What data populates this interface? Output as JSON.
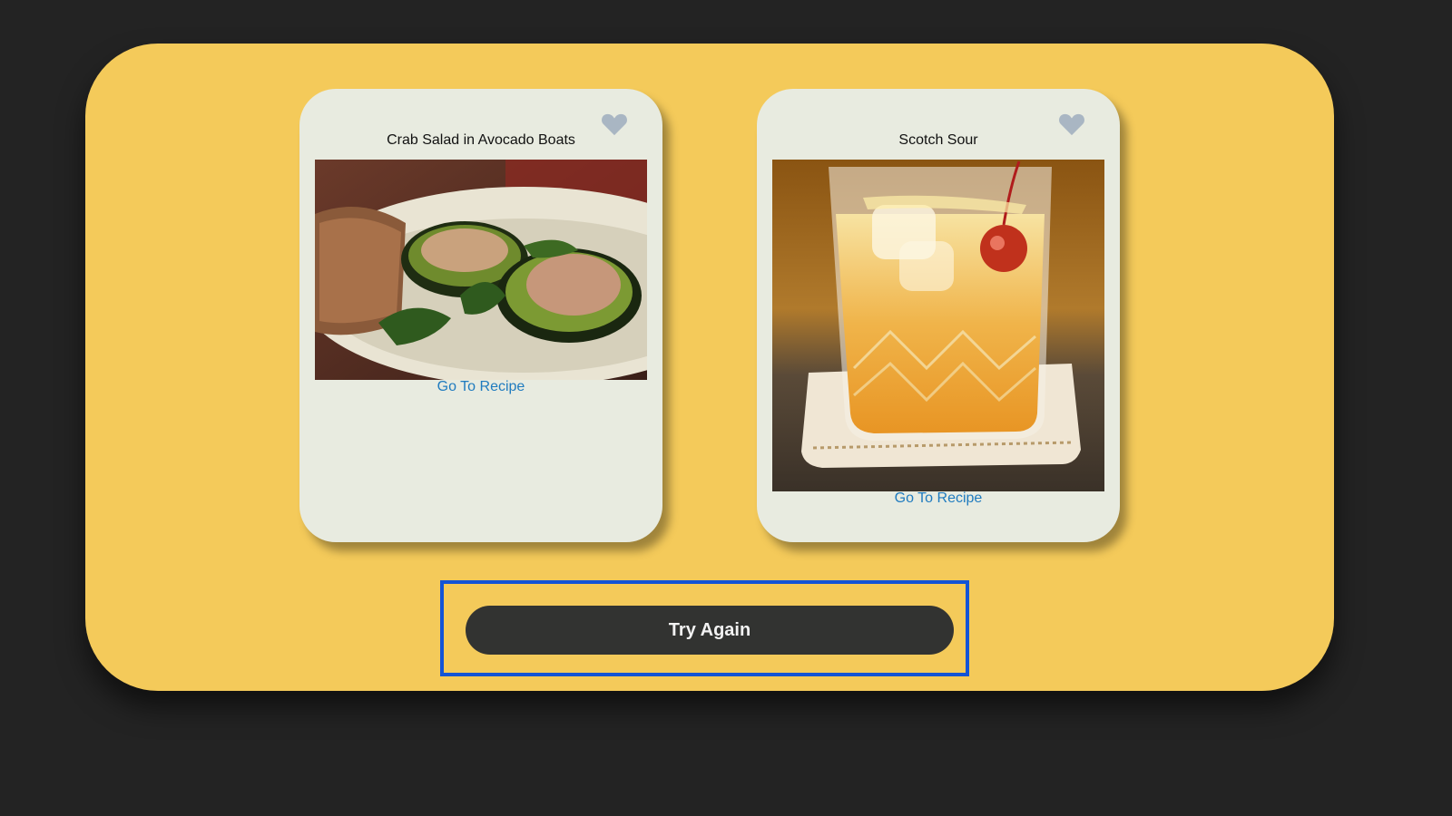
{
  "cards": [
    {
      "title": "Crab Salad in Avocado Boats",
      "link_label": "Go To Recipe",
      "favorite_icon": "heart-icon",
      "photo": "food-photo"
    },
    {
      "title": "Scotch Sour",
      "link_label": "Go To Recipe",
      "favorite_icon": "heart-icon",
      "photo": "drink-photo"
    }
  ],
  "action": {
    "button_label": "Try Again"
  },
  "colors": {
    "background": "#232323",
    "panel": "#f4ca5a",
    "card": "#e8ebe0",
    "link": "#1f7bbf",
    "button": "#323331",
    "focus_outline": "#1354d6",
    "heart": "#a9b6c3"
  }
}
